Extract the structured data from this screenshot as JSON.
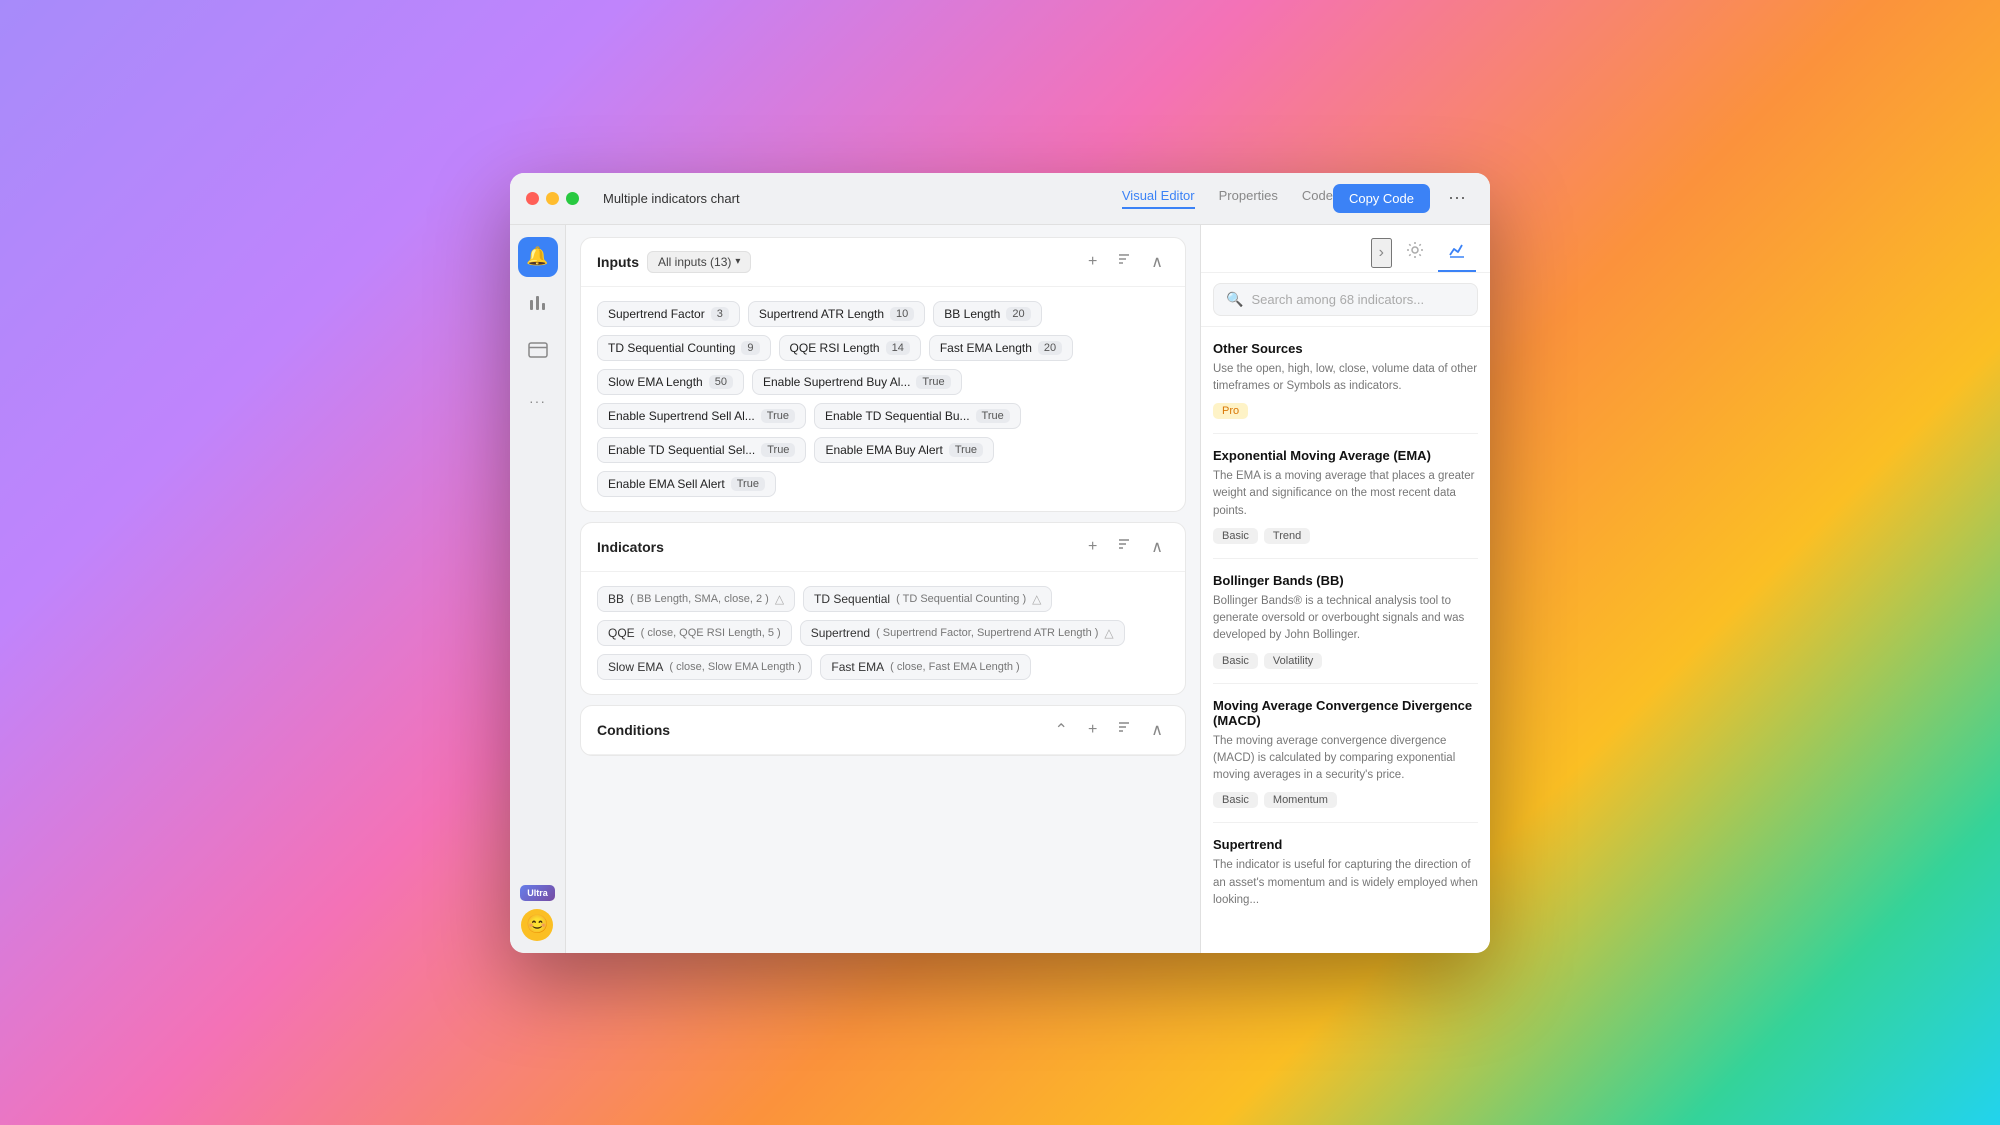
{
  "window": {
    "title": "Multiple indicators chart"
  },
  "tabs": [
    {
      "label": "Visual Editor",
      "active": true
    },
    {
      "label": "Properties",
      "active": false
    },
    {
      "label": "Code",
      "active": false
    }
  ],
  "toolbar": {
    "copy_code_label": "Copy Code",
    "more_icon": "⋯"
  },
  "sidebar": {
    "bell_icon": "🔔",
    "chart_icon": "📊",
    "card_icon": "🪪",
    "more_icon": "···",
    "ultra_label": "Ultra",
    "avatar_emoji": "😊"
  },
  "inputs_section": {
    "title": "Inputs",
    "filter_label": "All inputs (13)",
    "chips": [
      {
        "label": "Supertrend Factor",
        "value": "3"
      },
      {
        "label": "Supertrend ATR Length",
        "value": "10"
      },
      {
        "label": "BB Length",
        "value": "20"
      },
      {
        "label": "TD Sequential Counting",
        "value": "9"
      },
      {
        "label": "QQE RSI Length",
        "value": "14"
      },
      {
        "label": "Fast EMA Length",
        "value": "20"
      },
      {
        "label": "Slow EMA Length",
        "value": "50"
      },
      {
        "label": "Enable Supertrend Buy Al...",
        "value": "True"
      },
      {
        "label": "Enable Supertrend Sell Al...",
        "value": "True"
      },
      {
        "label": "Enable TD Sequential Bu...",
        "value": "True"
      },
      {
        "label": "Enable TD Sequential Sel...",
        "value": "True"
      },
      {
        "label": "Enable EMA Buy Alert",
        "value": "True"
      },
      {
        "label": "Enable EMA Sell Alert",
        "value": "True"
      }
    ]
  },
  "indicators_section": {
    "title": "Indicators",
    "items": [
      {
        "name": "BB",
        "params": "( BB Length, SMA, close, 2 )",
        "has_alert": true
      },
      {
        "name": "TD Sequential",
        "params": "( TD Sequential Counting )",
        "has_alert": true
      },
      {
        "name": "QQE",
        "params": "( close, QQE RSI Length, 5 )",
        "has_alert": false
      },
      {
        "name": "Supertrend",
        "params": "( Supertrend Factor, Supertrend ATR Length )",
        "has_alert": true
      },
      {
        "name": "Slow EMA",
        "params": "( close, Slow EMA Length )",
        "has_alert": false
      },
      {
        "name": "Fast EMA",
        "params": "( close, Fast EMA Length )",
        "has_alert": false
      }
    ]
  },
  "conditions_section": {
    "title": "Conditions"
  },
  "right_panel": {
    "search_placeholder": "Search among 68 indicators...",
    "search_count": 68,
    "indicator_cards": [
      {
        "name": "Other Sources",
        "desc": "Use the open, high, low, close, volume data of other timeframes or Symbols as indicators.",
        "tags": [
          {
            "label": "Pro",
            "type": "pro"
          }
        ]
      },
      {
        "name": "Exponential Moving Average (EMA)",
        "desc": "The EMA is a moving average that places a greater weight and significance on the most recent data points.",
        "tags": [
          {
            "label": "Basic",
            "type": "normal"
          },
          {
            "label": "Trend",
            "type": "normal"
          }
        ]
      },
      {
        "name": "Bollinger Bands (BB)",
        "desc": "Bollinger Bands® is a technical analysis tool to generate oversold or overbought signals and was developed by John Bollinger.",
        "tags": [
          {
            "label": "Basic",
            "type": "normal"
          },
          {
            "label": "Volatility",
            "type": "normal"
          }
        ]
      },
      {
        "name": "Moving Average Convergence Divergence (MACD)",
        "desc": "The moving average convergence divergence (MACD) is calculated by comparing exponential moving averages in a security's price.",
        "tags": [
          {
            "label": "Basic",
            "type": "normal"
          },
          {
            "label": "Momentum",
            "type": "normal"
          }
        ]
      },
      {
        "name": "Supertrend",
        "desc": "The indicator is useful for capturing the direction of an asset's momentum and is widely employed when looking...",
        "tags": []
      }
    ]
  }
}
